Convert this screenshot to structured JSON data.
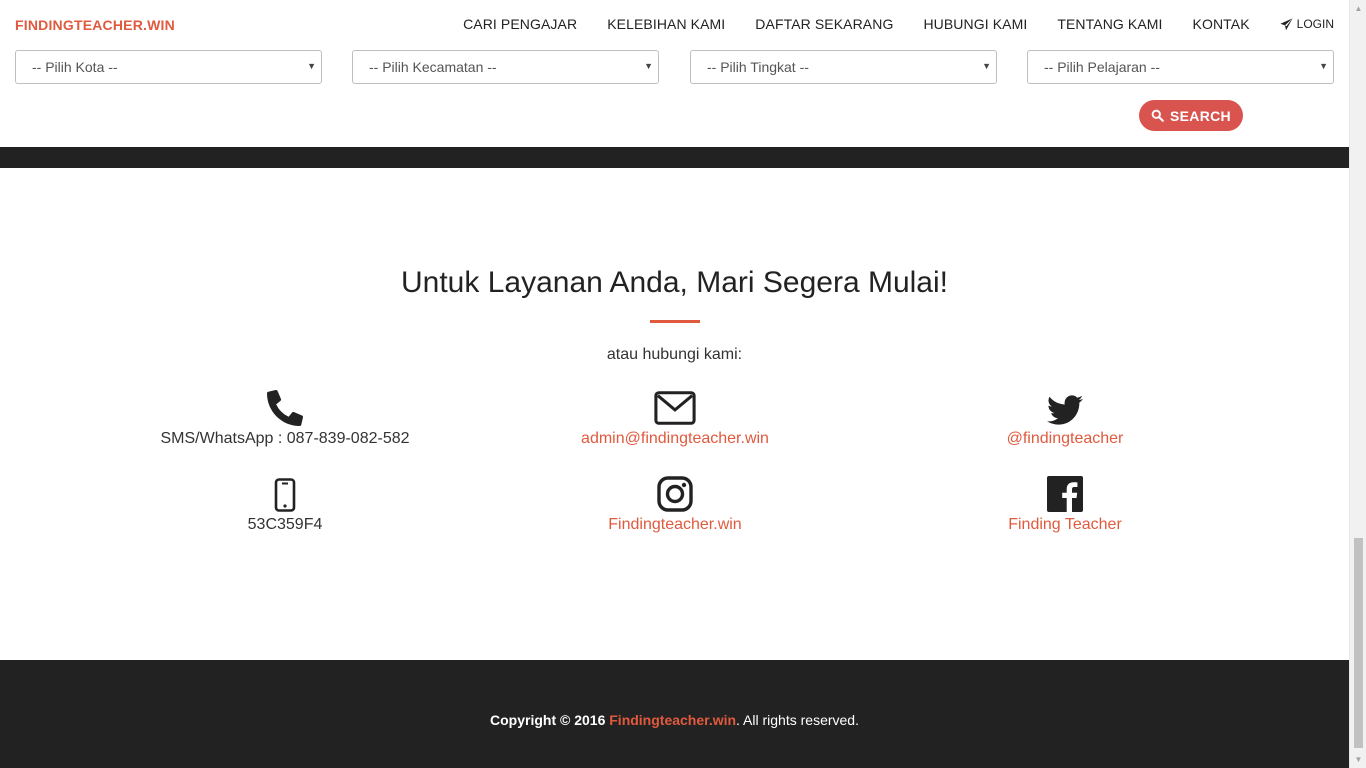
{
  "nav": {
    "brand": "FINDINGTEACHER.WIN",
    "links": [
      "CARI PENGAJAR",
      "KELEBIHAN KAMI",
      "DAFTAR SEKARANG",
      "HUBUNGI KAMI",
      "TENTANG KAMI",
      "KONTAK"
    ],
    "login": "LOGIN"
  },
  "filters": {
    "kota": "-- Pilih Kota --",
    "kecamatan": "-- Pilih Kecamatan --",
    "tingkat": "-- Pilih Tingkat --",
    "pelajaran": "-- Pilih Pelajaran --",
    "search": "SEARCH"
  },
  "contact": {
    "title": "Untuk Layanan Anda, Mari Segera Mulai!",
    "subtitle": "atau hubungi kami:",
    "phone": "SMS/WhatsApp : 087-839-082-582",
    "email": "admin@findingteacher.win",
    "twitter": "@findingteacher",
    "pin": "53C359F4",
    "instagram": "Findingteacher.win",
    "facebook": "Finding Teacher"
  },
  "footer": {
    "prefix": "Copyright © 2016",
    "brand": "Findingteacher.win",
    "suffix": ". All rights reserved."
  },
  "colors": {
    "accent": "#e05a3e",
    "dark": "#222222",
    "button": "#d9534f"
  },
  "icons": [
    "phone-icon",
    "envelope-icon",
    "twitter-icon",
    "mobile-icon",
    "instagram-icon",
    "facebook-icon",
    "search-icon",
    "send-icon"
  ]
}
